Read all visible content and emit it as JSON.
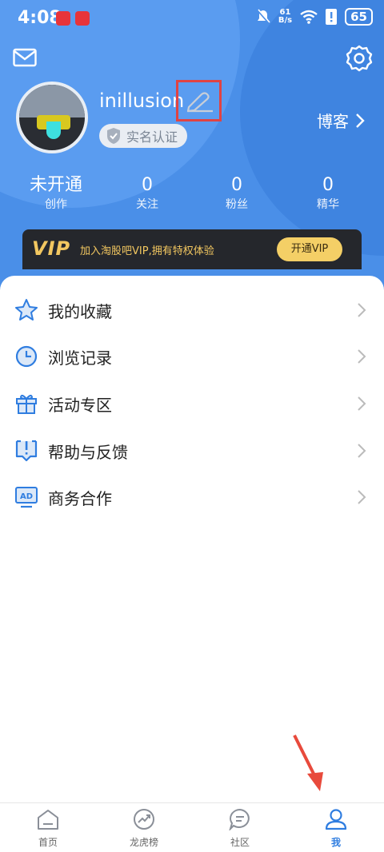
{
  "status_bar": {
    "time": "4:08",
    "net_speed_value": "61",
    "net_speed_unit": "B/s",
    "battery": "65"
  },
  "profile": {
    "username": "inillusion",
    "verify_label": "实名认证",
    "blog_label": "博客"
  },
  "stats": [
    {
      "value": "未开通",
      "label": "创作"
    },
    {
      "value": "0",
      "label": "关注"
    },
    {
      "value": "0",
      "label": "粉丝"
    },
    {
      "value": "0",
      "label": "精华"
    }
  ],
  "vip": {
    "logo": "VIP",
    "text": "加入淘股吧VIP,拥有特权体验",
    "button": "开通VIP"
  },
  "menu": [
    {
      "label": "我的收藏",
      "icon": "star-icon"
    },
    {
      "label": "浏览记录",
      "icon": "clock-icon"
    },
    {
      "label": "活动专区",
      "icon": "gift-icon"
    },
    {
      "label": "帮助与反馈",
      "icon": "help-icon"
    },
    {
      "label": "商务合作",
      "icon": "ad-icon"
    }
  ],
  "tabs": [
    {
      "label": "首页",
      "icon": "home-icon"
    },
    {
      "label": "龙虎榜",
      "icon": "trend-icon"
    },
    {
      "label": "社区",
      "icon": "chat-icon"
    },
    {
      "label": "我",
      "icon": "user-icon",
      "active": true
    }
  ],
  "colors": {
    "header_blue": "#4a8fe8",
    "accent_blue": "#2f7de0",
    "vip_gold": "#f2c760",
    "annotation_red": "#e04343"
  }
}
